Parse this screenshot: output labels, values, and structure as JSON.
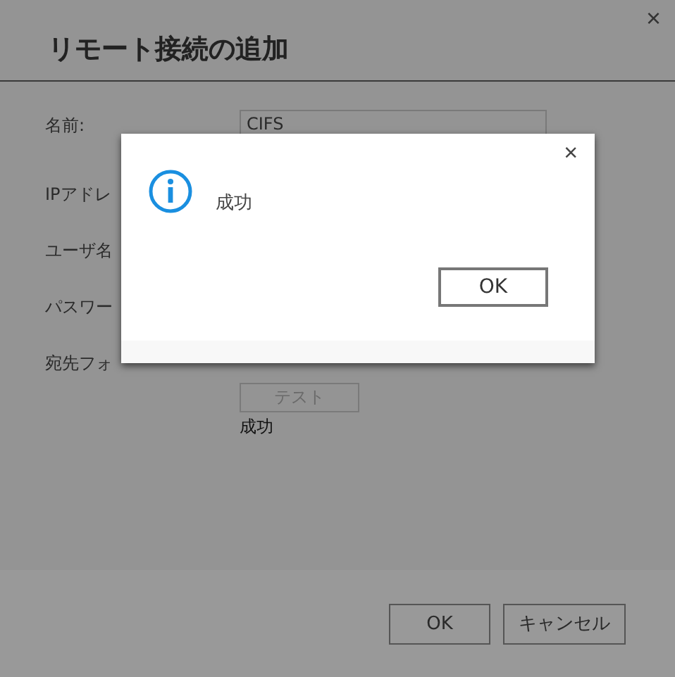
{
  "dialog": {
    "title": "リモート接続の追加",
    "close": "×",
    "fields": [
      {
        "label": "名前:",
        "value": "CIFS"
      },
      {
        "label": "IPアドレ"
      },
      {
        "label": "ユーザ名"
      },
      {
        "label": "パスワー"
      },
      {
        "label": "宛先フォ"
      }
    ],
    "test_button": {
      "label": "テスト",
      "disabled": true
    },
    "test_result": "成功",
    "buttons": [
      "OK",
      "キャンセル"
    ]
  },
  "message_box": {
    "close": "×",
    "message": "成功",
    "buttons": [
      "OK"
    ]
  }
}
